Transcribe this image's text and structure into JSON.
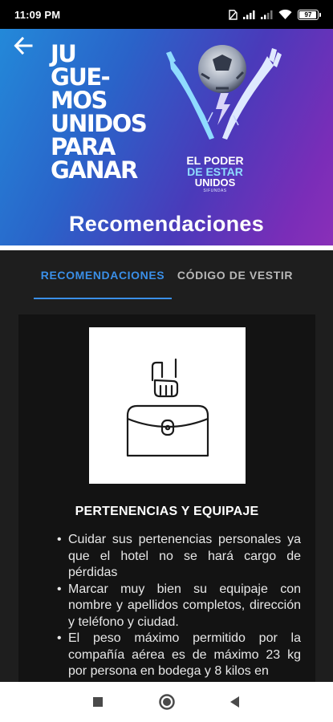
{
  "status_bar": {
    "time": "11:09 PM",
    "battery": "97",
    "battery_level": 0.97,
    "icons": [
      "sim-icon",
      "signal-icon",
      "signal-icon",
      "wifi-icon",
      "battery-icon"
    ]
  },
  "banner": {
    "slogan_lines": [
      "JU",
      "GUE-",
      "MOS",
      "UNIDOS",
      "PARA",
      "GANAR"
    ],
    "logo_lines": [
      "EL PODER",
      "DE ESTAR",
      "UNIDOS"
    ],
    "logo_sponsor": "SIFUNDAS",
    "title": "Recomendaciones"
  },
  "tabs": [
    {
      "label": "RECOMENDACIONES",
      "active": true
    },
    {
      "label": "CÓDIGO DE VESTIR",
      "active": false
    }
  ],
  "section": {
    "illustration": "suitcase-hand-icon",
    "title": "PERTENENCIAS Y EQUIPAJE",
    "items": [
      "Cuidar sus pertenencias personales ya que el hotel no se hará cargo de pérdidas",
      "Marcar muy bien su equipaje con nombre y apellidos completos, dirección y teléfono y ciudad.",
      "El peso máximo permitido por la compañía aérea es de máximo 23 kg por persona en bodega y 8 kilos en"
    ]
  },
  "colors": {
    "accent": "#3a8fe8",
    "background": "#1e1e1e",
    "panel": "#131313",
    "banner_start": "#2389d9",
    "banner_end": "#8a2fb8"
  }
}
